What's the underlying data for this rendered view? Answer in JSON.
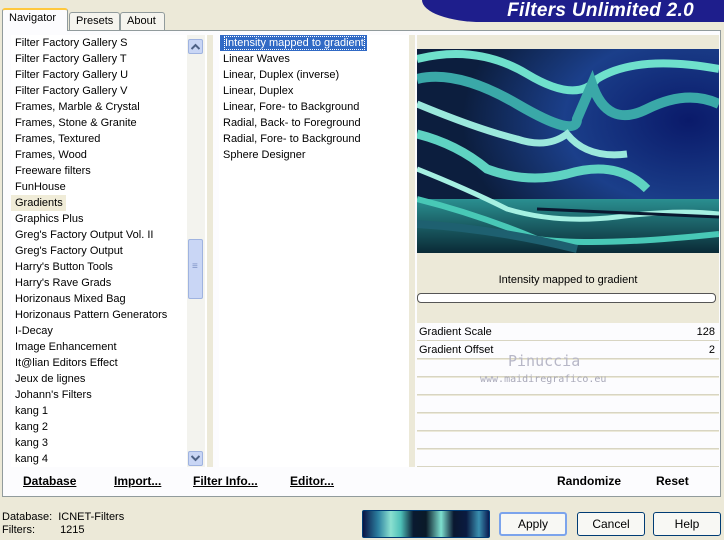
{
  "tabs": [
    "Navigator",
    "Presets",
    "About"
  ],
  "banner_title": "Filters Unlimited 2.0",
  "categories": [
    "Filter Factory Gallery S",
    "Filter Factory Gallery T",
    "Filter Factory Gallery U",
    "Filter Factory Gallery V",
    "Frames, Marble & Crystal",
    "Frames, Stone & Granite",
    "Frames, Textured",
    "Frames, Wood",
    "Freeware filters",
    "FunHouse",
    "Gradients",
    "Graphics Plus",
    "Greg's Factory Output Vol. II",
    "Greg's Factory Output",
    "Harry's Button Tools",
    "Harry's Rave Grads",
    "Horizonaus Mixed Bag",
    "Horizonaus Pattern Generators",
    "I-Decay",
    "Image Enhancement",
    "It@lian Editors Effect",
    "Jeux de lignes",
    "Johann's Filters",
    "kang 1",
    "kang 2",
    "kang 3",
    "kang 4"
  ],
  "filters": [
    "Intensity mapped to gradient",
    "Linear Waves",
    "Linear, Duplex (inverse)",
    "Linear, Duplex",
    "Linear, Fore- to Background",
    "Radial, Back- to Foreground",
    "Radial, Fore- to Background",
    "Sphere Designer"
  ],
  "selected_filter_title": "Intensity mapped to gradient",
  "params": [
    {
      "label": "Gradient Scale",
      "value": "128"
    },
    {
      "label": "Gradient Offset",
      "value": "2"
    }
  ],
  "watermark": {
    "name": "Pinuccia",
    "url": "www.maidiregrafico.eu"
  },
  "bottom_buttons": {
    "database": "Database",
    "import": "Import...",
    "filter_info": "Filter Info...",
    "editor": "Editor...",
    "randomize": "Randomize",
    "reset": "Reset"
  },
  "status": {
    "database_label": "Database:",
    "database_value": "ICNET-Filters",
    "filters_label": "Filters:",
    "filters_value": "1215"
  },
  "dialog_buttons": {
    "apply": "Apply",
    "cancel": "Cancel",
    "help": "Help"
  },
  "colors": {
    "banner": "#1e1e8c",
    "selection": "#316ac5",
    "window_bg": "#ece9d8"
  }
}
